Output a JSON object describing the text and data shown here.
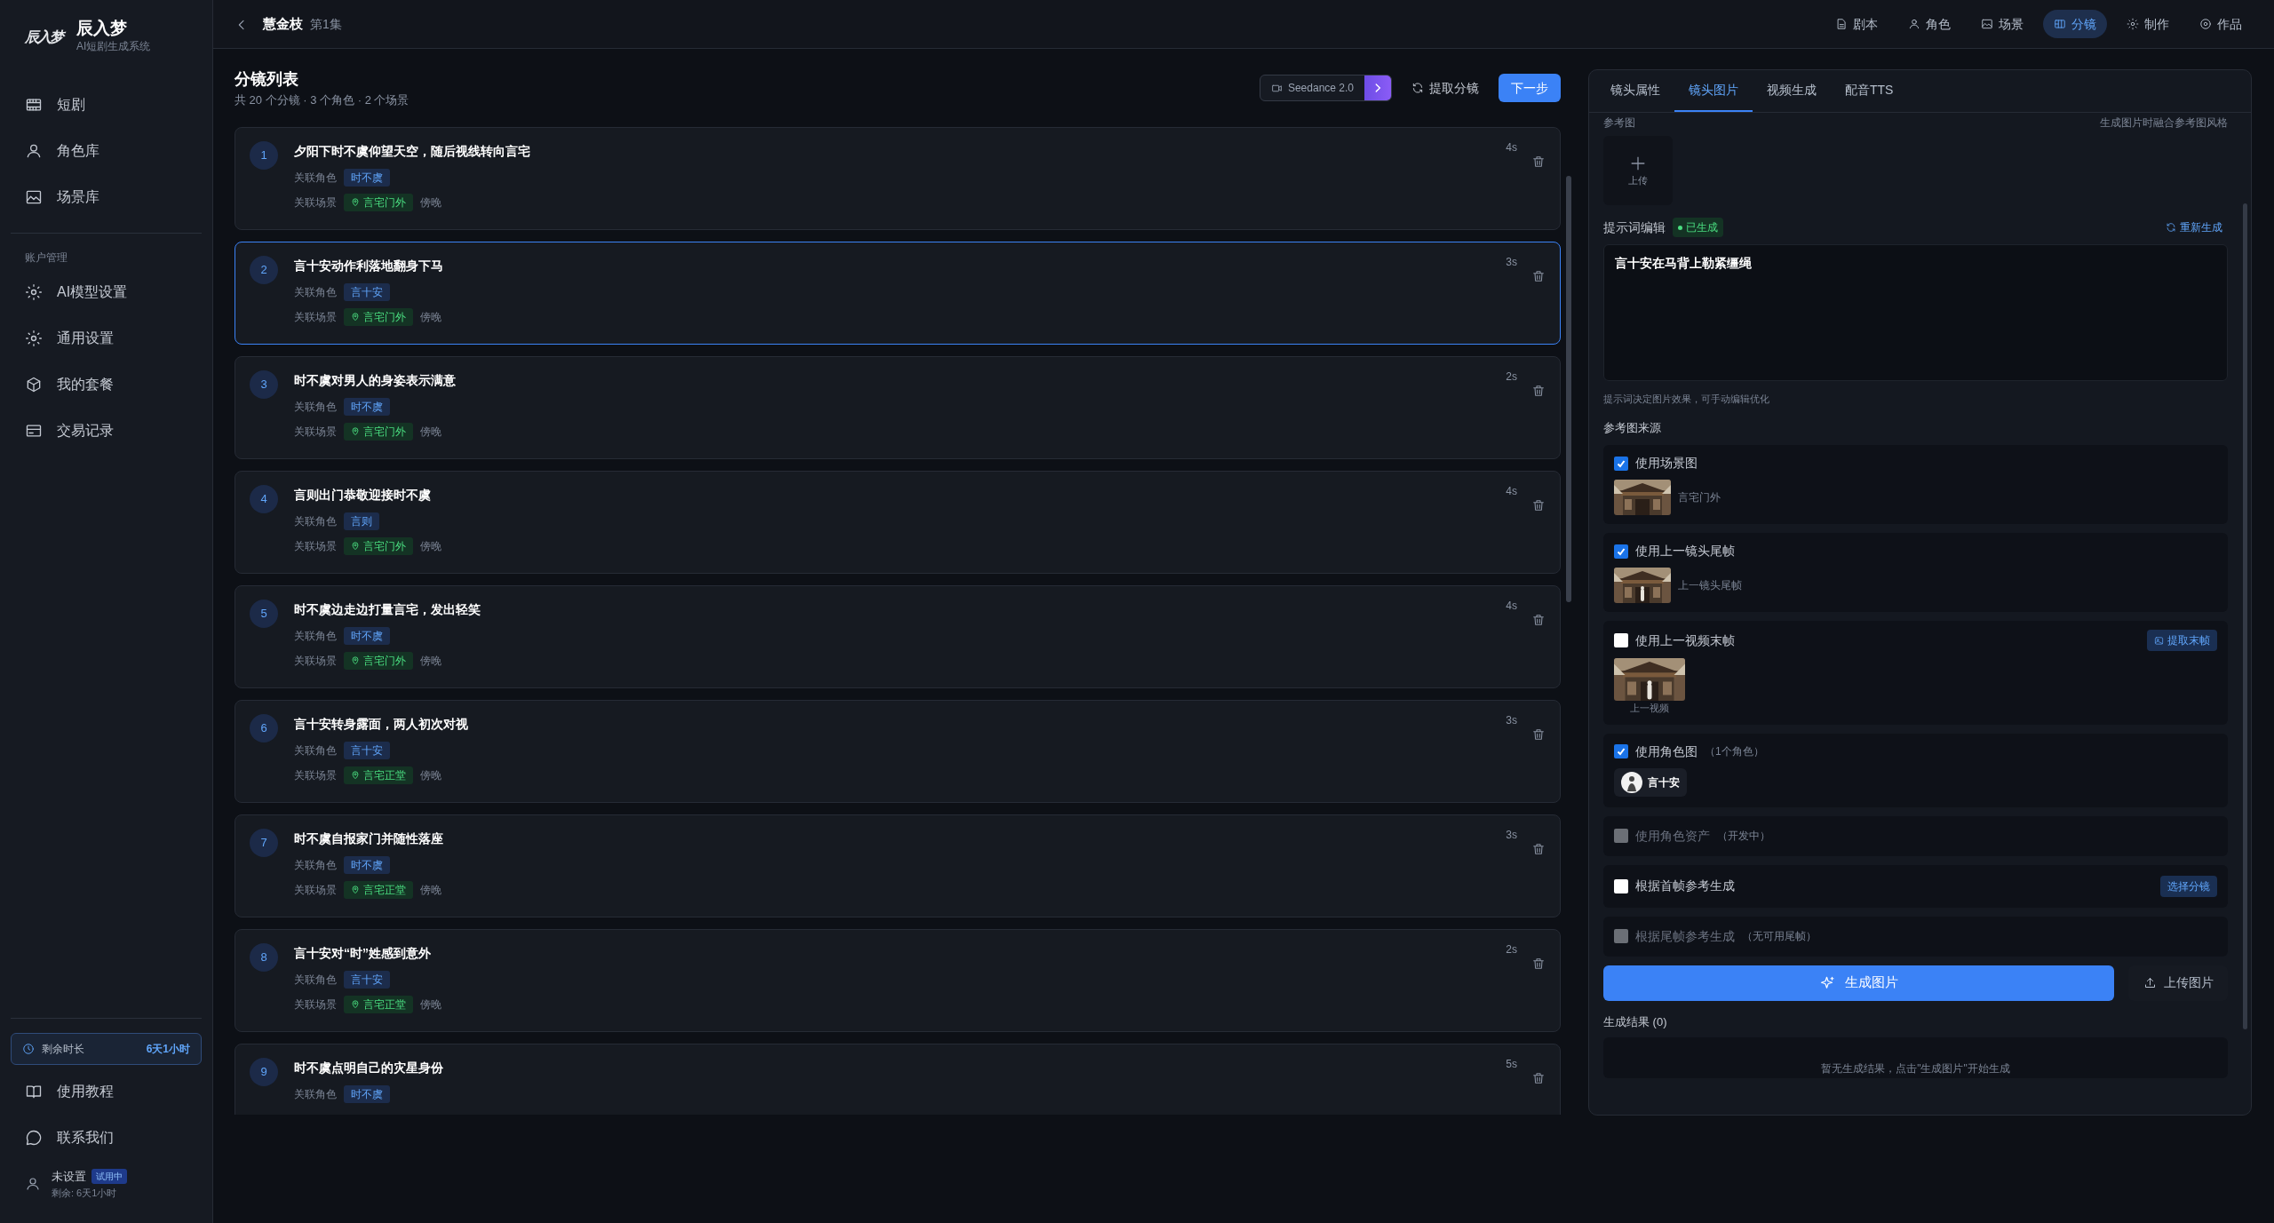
{
  "sidebar": {
    "logo_mark": "辰入梦",
    "brand": "辰入梦",
    "tagline": "AI短剧生成系统",
    "items": [
      {
        "label": "短剧"
      },
      {
        "label": "角色库"
      },
      {
        "label": "场景库"
      }
    ],
    "section_title": "账户管理",
    "account_items": [
      {
        "label": "AI模型设置"
      },
      {
        "label": "通用设置"
      },
      {
        "label": "我的套餐"
      },
      {
        "label": "交易记录"
      }
    ],
    "remaining": {
      "label": "剩余时长",
      "value": "6天1小时"
    },
    "links": [
      {
        "label": "使用教程"
      },
      {
        "label": "联系我们"
      }
    ],
    "user": {
      "name": "未设置",
      "badge": "试用中",
      "detail": "剩余: 6天1小时"
    }
  },
  "topbar": {
    "title": "慧金枝",
    "episode": "第1集",
    "nav": [
      {
        "label": "剧本",
        "selected": false
      },
      {
        "label": "角色",
        "selected": false
      },
      {
        "label": "场景",
        "selected": false
      },
      {
        "label": "分镜",
        "selected": true
      },
      {
        "label": "制作",
        "selected": false
      },
      {
        "label": "作品",
        "selected": false
      }
    ]
  },
  "list": {
    "title": "分镜列表",
    "subtitle": "共 20 个分镜 · 3 个角色 · 2 个场景",
    "model": "Seedance 2.0",
    "extract": "提取分镜",
    "next": "下一步",
    "items": [
      {
        "number": "1",
        "title": "夕阳下时不虞仰望天空，随后视线转向言宅",
        "duration": "4s",
        "role_label": "关联角色",
        "role": "时不虞",
        "scene_label": "关联场景",
        "scene": "言宅门外",
        "time": "傍晚",
        "selected": false
      },
      {
        "number": "2",
        "title": "言十安动作利落地翻身下马",
        "duration": "3s",
        "role_label": "关联角色",
        "role": "言十安",
        "scene_label": "关联场景",
        "scene": "言宅门外",
        "time": "傍晚",
        "selected": true
      },
      {
        "number": "3",
        "title": "时不虞对男人的身姿表示满意",
        "duration": "2s",
        "role_label": "关联角色",
        "role": "时不虞",
        "scene_label": "关联场景",
        "scene": "言宅门外",
        "time": "傍晚",
        "selected": false
      },
      {
        "number": "4",
        "title": "言则出门恭敬迎接时不虞",
        "duration": "4s",
        "role_label": "关联角色",
        "role": "言则",
        "scene_label": "关联场景",
        "scene": "言宅门外",
        "time": "傍晚",
        "selected": false
      },
      {
        "number": "5",
        "title": "时不虞边走边打量言宅，发出轻笑",
        "duration": "4s",
        "role_label": "关联角色",
        "role": "时不虞",
        "scene_label": "关联场景",
        "scene": "言宅门外",
        "time": "傍晚",
        "selected": false
      },
      {
        "number": "6",
        "title": "言十安转身露面，两人初次对视",
        "duration": "3s",
        "role_label": "关联角色",
        "role": "言十安",
        "scene_label": "关联场景",
        "scene": "言宅正堂",
        "time": "傍晚",
        "selected": false
      },
      {
        "number": "7",
        "title": "时不虞自报家门并随性落座",
        "duration": "3s",
        "role_label": "关联角色",
        "role": "时不虞",
        "scene_label": "关联场景",
        "scene": "言宅正堂",
        "time": "傍晚",
        "selected": false
      },
      {
        "number": "8",
        "title": "言十安对“时”姓感到意外",
        "duration": "2s",
        "role_label": "关联角色",
        "role": "言十安",
        "scene_label": "关联场景",
        "scene": "言宅正堂",
        "time": "傍晚",
        "selected": false
      },
      {
        "number": "9",
        "title": "时不虞点明自己的灾星身份",
        "duration": "5s",
        "role_label": "关联角色",
        "role": "时不虞",
        "selected": false
      }
    ]
  },
  "panel": {
    "tabs": [
      {
        "label": "镜头属性",
        "selected": false
      },
      {
        "label": "镜头图片",
        "selected": true
      },
      {
        "label": "视频生成",
        "selected": false
      },
      {
        "label": "配音TTS",
        "selected": false
      }
    ],
    "ref_title": "参考图",
    "ref_hint": "生成图片时融合参考图风格",
    "upload": "上传",
    "prompt_title": "提示词编辑",
    "prompt_status": "已生成",
    "regenerate": "重新生成",
    "prompt": "言十安在马背上勒紧缰绳",
    "prompt_note": "提示词决定图片效果，可手动编辑优化",
    "sources_title": "参考图来源",
    "sources": [
      {
        "kind": "thumb",
        "label": "使用场景图",
        "checked": true,
        "disabled": false,
        "caption": "言宅门外"
      },
      {
        "kind": "thumb",
        "label": "使用上一镜头尾帧",
        "checked": true,
        "disabled": false,
        "caption": "上一镜头尾帧"
      },
      {
        "kind": "video",
        "label": "使用上一视频末帧",
        "checked": false,
        "disabled": false,
        "action": "提取末帧",
        "caption": "上一视频"
      },
      {
        "kind": "character",
        "label": "使用角色图",
        "checked": true,
        "disabled": false,
        "note": "（1个角色）",
        "chip": "言十安"
      },
      {
        "kind": "plain",
        "label": "使用角色资产",
        "checked": false,
        "disabled": true,
        "note": "（开发中）"
      },
      {
        "kind": "plain",
        "label": "根据首帧参考生成",
        "checked": false,
        "disabled": false,
        "action": "选择分镜"
      },
      {
        "kind": "plain",
        "label": "根据尾帧参考生成",
        "checked": false,
        "disabled": true,
        "note": "（无可用尾帧）"
      }
    ],
    "generate": "生成图片",
    "upload_image": "上传图片",
    "results_title": "生成结果 (0)",
    "empty": "暂无生成结果，点击\"生成图片\"开始生成"
  }
}
